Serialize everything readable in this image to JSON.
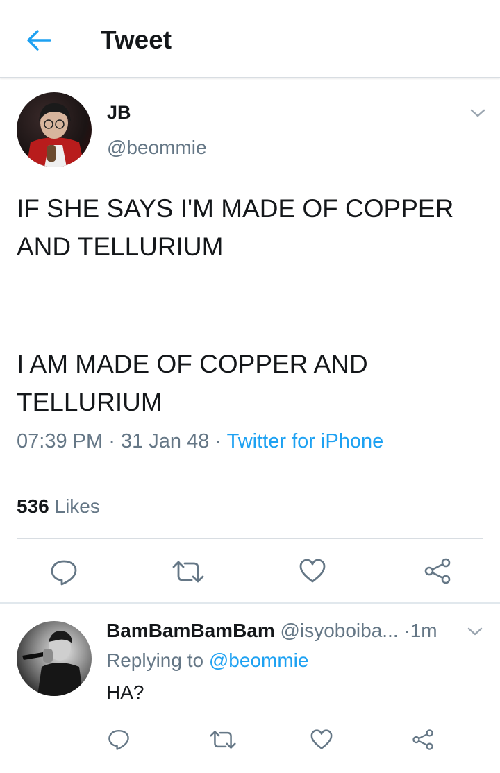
{
  "header": {
    "title": "Tweet"
  },
  "tweet": {
    "display_name": "JB",
    "handle": "@beommie",
    "text_line_1": "IF SHE SAYS I'M MADE OF COPPER AND TELLURIUM",
    "text_line_2": "I AM MADE OF COPPER AND TELLURIUM",
    "time": "07:39 PM",
    "date": "31 Jan 48",
    "separator": "·",
    "source": "Twitter for iPhone",
    "likes_count": "536",
    "likes_label": "Likes"
  },
  "reply": {
    "display_name": "BamBamBamBam",
    "handle": "@isyoboiba...",
    "separator": "·",
    "time": "1m",
    "replying_prefix": "Replying to",
    "replying_handle": "@beommie",
    "text": "HA?"
  },
  "colors": {
    "accent": "#1da1f2",
    "text": "#14171a",
    "muted": "#657786",
    "border": "#d8dde2"
  },
  "icons": [
    "back-arrow-icon",
    "chevron-down-icon",
    "reply-icon",
    "retweet-icon",
    "like-icon",
    "share-icon"
  ]
}
